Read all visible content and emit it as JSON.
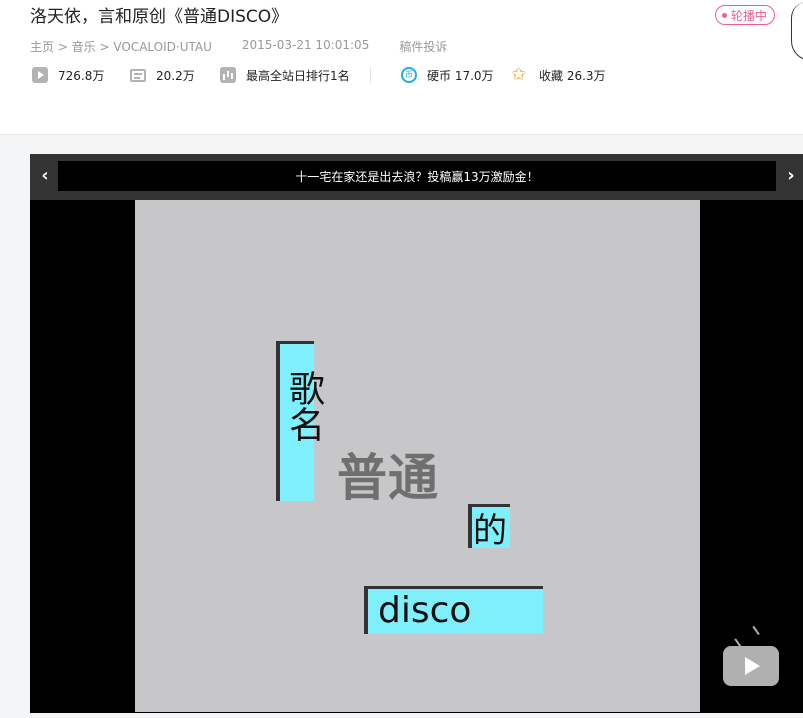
{
  "video": {
    "title": "洛天依，言和原创《普通DISCO》",
    "live_badge": "轮播中",
    "breadcrumb": "主页 > 音乐 > VOCALOID·UTAU",
    "publish_time": "2015-03-21 10:01:05",
    "report_link": "稿件投诉"
  },
  "stats": {
    "plays": "726.8万",
    "danmaku": "20.2万",
    "rank": "最高全站日排行1名",
    "coins": "硬币 17.0万",
    "favorites": "收藏 26.3万"
  },
  "player": {
    "banner": "十一宅在家还是出去浪？投稿赢13万激励金！",
    "prev_arrow": "‹",
    "next_arrow": "›",
    "frame_text": {
      "geming": "歌名",
      "putong": "普通",
      "de": "的",
      "disco": "disco"
    }
  },
  "colors": {
    "accent_pink": "#f25d8e",
    "coin_blue": "#23ade5",
    "fav_orange": "#f7a43b",
    "cyan_box": "#7ff0fb"
  },
  "icons": [
    "play-count-icon",
    "danmaku-icon",
    "rank-icon",
    "coin-icon",
    "favorite-icon",
    "tv-icon"
  ]
}
